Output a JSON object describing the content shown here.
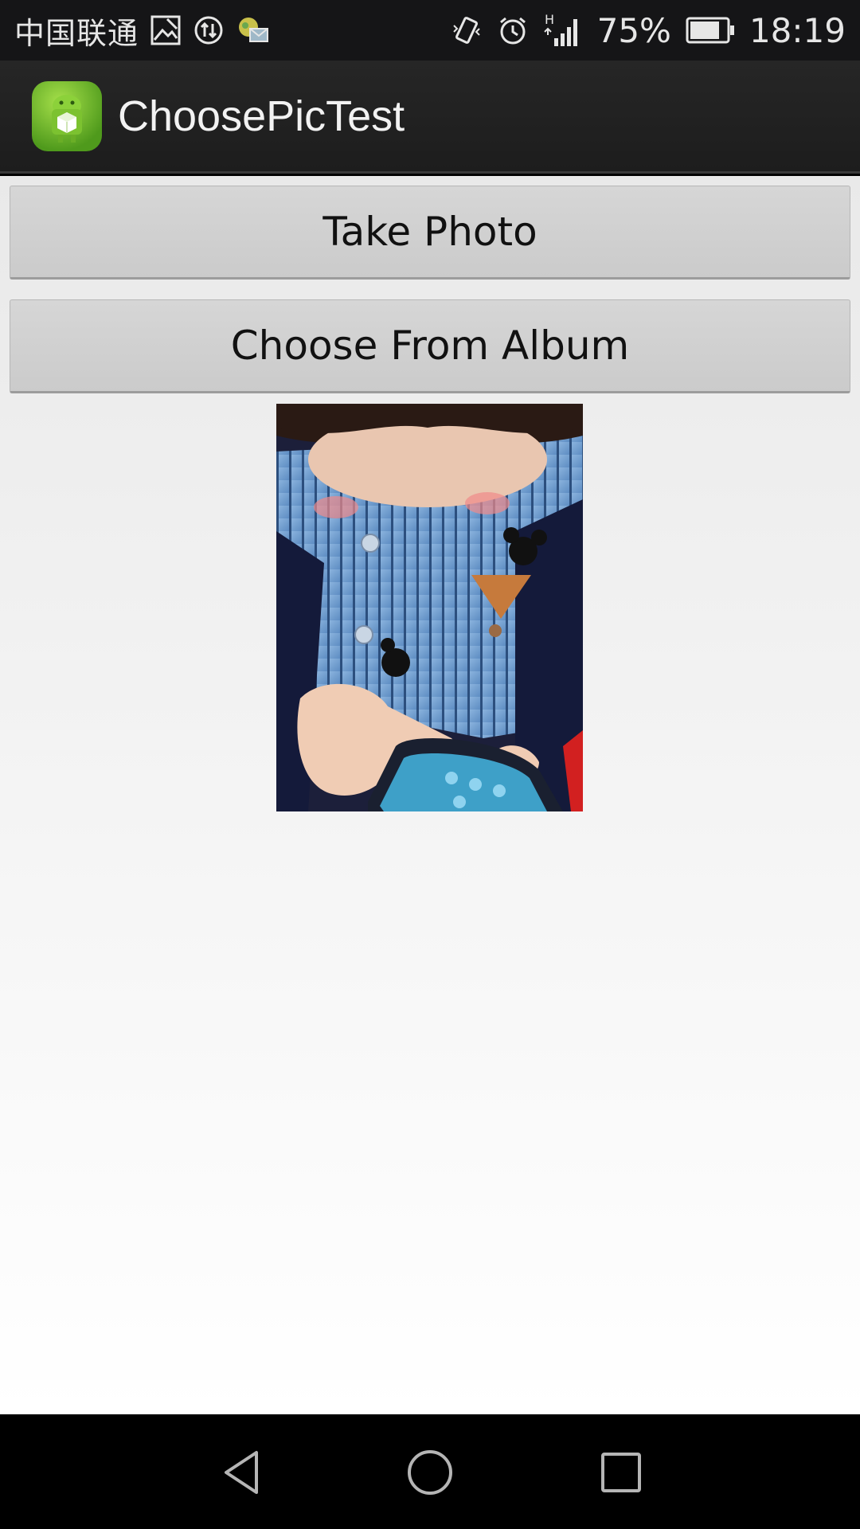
{
  "status_bar": {
    "carrier": "中国联通",
    "battery": "75%",
    "time": "18:19",
    "network_label": "H"
  },
  "app_bar": {
    "title": "ChoosePicTest",
    "logo_icon": "android-app-icon"
  },
  "buttons": {
    "take_photo": "Take Photo",
    "choose_album": "Choose From Album"
  },
  "photo": {
    "description_icon": "selected-photo-image"
  },
  "nav_bar": {
    "back_icon": "back-icon",
    "home_icon": "home-icon",
    "recents_icon": "recents-icon"
  },
  "colors": {
    "status_bar": "#151517",
    "app_bar": "#222222",
    "button": "#cfcfcf",
    "content_bg": "#f0f0f0",
    "nav_bar": "#000000"
  }
}
